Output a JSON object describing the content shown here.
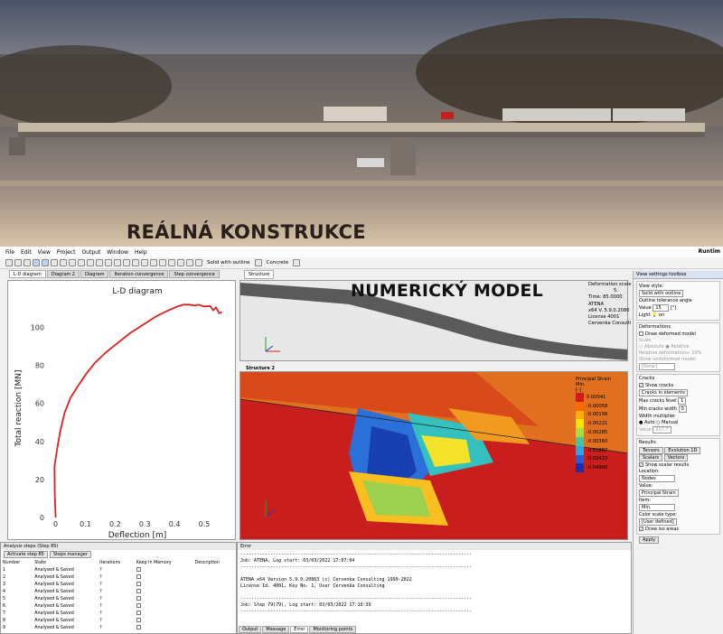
{
  "photo": {
    "title": "REÁLNÁ KONSTRUKCE"
  },
  "menu": [
    "File",
    "Edit",
    "View",
    "Project",
    "Output",
    "Window",
    "Help"
  ],
  "run_label": "Runtim",
  "toolbar": {
    "render_mode": "Solid with outline",
    "material": "Concrete"
  },
  "tabs": [
    "L-D diagram",
    "Diagram 2",
    "Diagram",
    "Iteration convergence",
    "Step convergence"
  ],
  "structure_tab": "Structure",
  "structure2_tab": "Structure 2",
  "numeric_title": "NUMERICKÝ MODEL",
  "info": {
    "deformation_scale_label": "Deformation scale",
    "deformation_scale": "5.",
    "time": "Time: 85.0000",
    "lines": [
      "ATENA",
      "x64 V. 5.9.0.2086",
      "License 4001",
      "Cervenka Consulti"
    ]
  },
  "legend": {
    "title": [
      "Principal Strain",
      "Min.",
      "[-]"
    ],
    "values": [
      "0.00041",
      "-0.00058",
      "-0.00156",
      "-0.00221",
      "-0.00285",
      "-0.00360",
      "-0.01887",
      "-0.03423",
      "-0.04960"
    ],
    "colors": [
      "#d71818",
      "#ff6a00",
      "#ffb000",
      "#f5e600",
      "#a8de3c",
      "#3ec8a0",
      "#23a8e4",
      "#2060e0",
      "#1830b0"
    ]
  },
  "toolbox": {
    "header": "View settings toolbox",
    "view_style_label": "View style:",
    "view_style": "Solid with outline",
    "outline_label": "Outline tolerance angle",
    "value_label": "Value",
    "value": "15",
    "unit": "[°]",
    "light_label": "Light",
    "light_value": "on",
    "deformations_header": "Deformations",
    "draw_deformed": "Draw deformed model",
    "scale_label": "Scale",
    "absolute": "Absolute",
    "relative": "Relative",
    "relative_def": "Relative deformations:",
    "relative_val": "10%",
    "show_undeformed": "Show undeformed model",
    "none": "[None]",
    "cracks_header": "Cracks",
    "show_cracks": "Show cracks",
    "cracks_in": "Cracks in elements",
    "max_cracks": "Max cracks level",
    "max_cracks_val": "1",
    "min_width": "Min cracks width",
    "min_width_val": "0",
    "width_mult": "Width multiplier",
    "auto": "Auto",
    "manual": "Manual",
    "value2_label": "Value",
    "value2": "207.7",
    "results_header": "Results",
    "tensors": "Tensors",
    "evolution": "Evolution 1D",
    "scalars": "Scalars",
    "vectors": "Vectors",
    "show_scalar": "Show scalar results",
    "location_label": "Location:",
    "location": "Nodes",
    "value3_label": "Value:",
    "value3": "Principal Strain",
    "item_label": "Item:",
    "item": "Min.",
    "color_scale_label": "Color scale type:",
    "color_scale": "[User defined]",
    "draw_iso": "Draw iso areas",
    "apply": "Apply"
  },
  "chart_data": {
    "type": "line",
    "title": "L-D diagram",
    "xlabel": "Deflection [m]",
    "ylabel": "Total reaction [MN]",
    "xlim": [
      -0.02,
      0.57
    ],
    "ylim": [
      0,
      115
    ],
    "xticks": [
      0,
      0.1,
      0.2,
      0.3,
      0.4,
      0.5
    ],
    "yticks": [
      0,
      20,
      40,
      60,
      80,
      100
    ],
    "xtick_labels": [
      "0",
      "0.1",
      "0.2",
      "0.3",
      "0.4",
      "0.5"
    ],
    "ytick_labels": [
      "0",
      "20",
      "40",
      "60",
      "80",
      "100"
    ],
    "grid": false,
    "color": "#e02020",
    "x": [
      0,
      -0.003,
      -0.004,
      0.005,
      0.015,
      0.03,
      0.05,
      0.07,
      0.1,
      0.13,
      0.17,
      0.21,
      0.25,
      0.3,
      0.34,
      0.38,
      0.41,
      0.43,
      0.45,
      0.47,
      0.48,
      0.5,
      0.52,
      0.53,
      0.54,
      0.55,
      0.56
    ],
    "y": [
      0,
      12,
      27,
      36,
      45,
      55,
      63,
      68,
      75,
      81,
      87,
      92,
      97,
      102,
      106,
      109,
      111,
      112,
      112,
      111.5,
      112,
      111,
      111.3,
      109,
      110.5,
      107.5,
      108
    ]
  },
  "steps": {
    "header": "Analysis steps (Step 85)",
    "activate_tab": "Activate step 85",
    "manager_tab": "Steps manager",
    "columns": [
      "Number",
      "State",
      "Iterations",
      "Keep in Memory",
      "Description"
    ],
    "rows": [
      [
        "1",
        "Analysed & Saved",
        "?"
      ],
      [
        "2",
        "Analysed & Saved",
        "?"
      ],
      [
        "3",
        "Analysed & Saved",
        "?"
      ],
      [
        "4",
        "Analysed & Saved",
        "?"
      ],
      [
        "5",
        "Analysed & Saved",
        "?"
      ],
      [
        "6",
        "Analysed & Saved",
        "?"
      ],
      [
        "7",
        "Analysed & Saved",
        "?"
      ],
      [
        "8",
        "Analysed & Saved",
        "?"
      ],
      [
        "9",
        "Analysed & Saved",
        "?"
      ]
    ]
  },
  "error": {
    "header": "Error",
    "lines": [
      "-------------------------------------------------------------------------------------",
      "Job: ATENA, Log start: 03/03/2022 17:07:04",
      "-------------------------------------------------------------------------------------",
      "",
      "ATENA x64 Version 5.9.0.20863 (c) Cervenka Consulting 1999-2022",
      "License Id. 4001, Key No. 1, User Cervenka Consulting",
      "",
      "-------------------------------------------------------------------------------------",
      "Job: Step 79(79), Log start: 03/03/2022 17:10:39",
      "-------------------------------------------------------------------------------------"
    ]
  },
  "bottom_tabs": [
    "Output",
    "Message",
    "Error",
    "Monitoring points"
  ]
}
